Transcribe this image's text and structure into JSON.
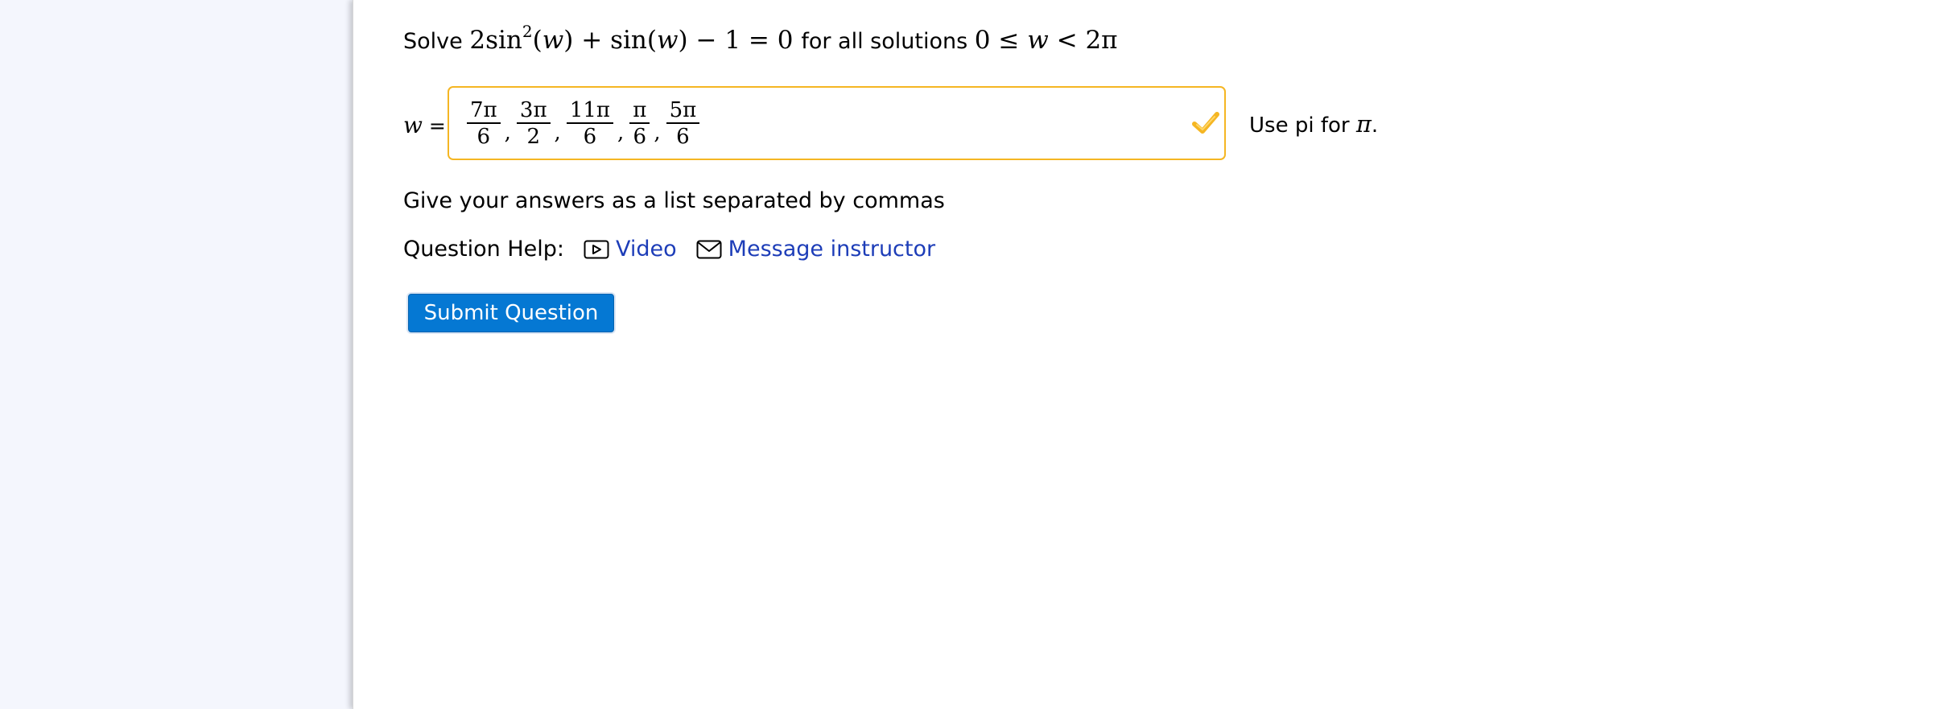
{
  "question": {
    "lead": "Solve",
    "equation": {
      "coef": "2",
      "func": "sin",
      "exp": "2",
      "var": "w",
      "rest_plus": "+",
      "rest_func": "sin",
      "rest_minus": "−",
      "rest_one": "1",
      "rest_eq": "=",
      "rest_zero": "0"
    },
    "middle": "for all solutions",
    "range": {
      "low": "0",
      "le": "≤",
      "var": "w",
      "lt": "<",
      "high": "2π"
    }
  },
  "answer": {
    "label_var": "w",
    "label_eq": "=",
    "fractions": [
      {
        "num": "7π",
        "den": "6"
      },
      {
        "num": "3π",
        "den": "2"
      },
      {
        "num": "11π",
        "den": "6"
      },
      {
        "num": "π",
        "den": "6"
      },
      {
        "num": "5π",
        "den": "6"
      }
    ],
    "separator": ",",
    "status_icon": "check-icon",
    "status_color": "#f5b623"
  },
  "hint": {
    "text": "Use pi for",
    "symbol": "π",
    "end": "."
  },
  "instructions": "Give your answers as a list separated by commas",
  "help": {
    "label": "Question Help:",
    "video_label": "Video",
    "video_icon": "video-icon",
    "message_label": "Message instructor",
    "message_icon": "mail-icon",
    "link_color": "#1d3db8"
  },
  "submit_label": "Submit Question",
  "colors": {
    "accent": "#0578d3",
    "sidebar_bg": "#f4f6fd",
    "panel_bg": "#ffffff"
  }
}
